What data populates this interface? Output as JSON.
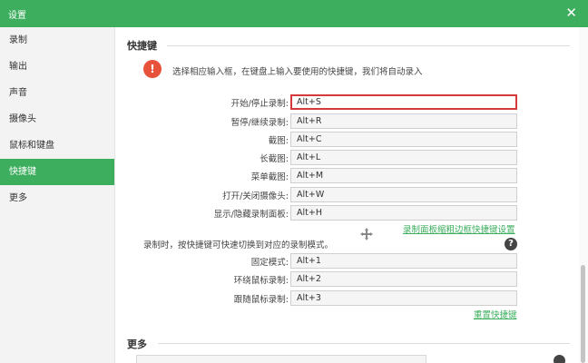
{
  "window": {
    "title": "设置",
    "close_icon": "close-icon"
  },
  "sidebar": {
    "items": [
      {
        "label": "录制",
        "active": false
      },
      {
        "label": "输出",
        "active": false
      },
      {
        "label": "声音",
        "active": false
      },
      {
        "label": "摄像头",
        "active": false
      },
      {
        "label": "鼠标和键盘",
        "active": false
      },
      {
        "label": "快捷键",
        "active": true
      },
      {
        "label": "更多",
        "active": false
      }
    ],
    "active_color": "#3cae5e"
  },
  "hotkeys": {
    "section_title": "快捷键",
    "info_icon": "warning-icon",
    "info_text": "选择相应输入框，在键盘上输入要使用的快捷键，我们将自动录入",
    "rows": [
      {
        "label": "开始/停止录制:",
        "value": "Alt+S",
        "focused": true
      },
      {
        "label": "暂停/继续录制:",
        "value": "Alt+R"
      },
      {
        "label": "截图:",
        "value": "Alt+C"
      },
      {
        "label": "长截图:",
        "value": "Alt+L"
      },
      {
        "label": "菜单截图:",
        "value": "Alt+M"
      },
      {
        "label": "打开/关闭摄像头:",
        "value": "Alt+W"
      },
      {
        "label": "显示/隐藏录制面板:",
        "value": "Alt+H"
      }
    ],
    "panel_link": "录制面板缩粗边框快捷键设置",
    "mode_hint": "录制时，按快捷键可快速切换到对应的录制模式。",
    "help_icon": "?",
    "mode_rows": [
      {
        "label": "固定模式:",
        "value": "Alt+1"
      },
      {
        "label": "环绕鼠标录制:",
        "value": "Alt+2"
      },
      {
        "label": "跟随鼠标录制:",
        "value": "Alt+3"
      }
    ],
    "reset_link": "重置快捷键",
    "focus_color": "#d43a3a"
  },
  "more": {
    "section_title": "更多"
  }
}
